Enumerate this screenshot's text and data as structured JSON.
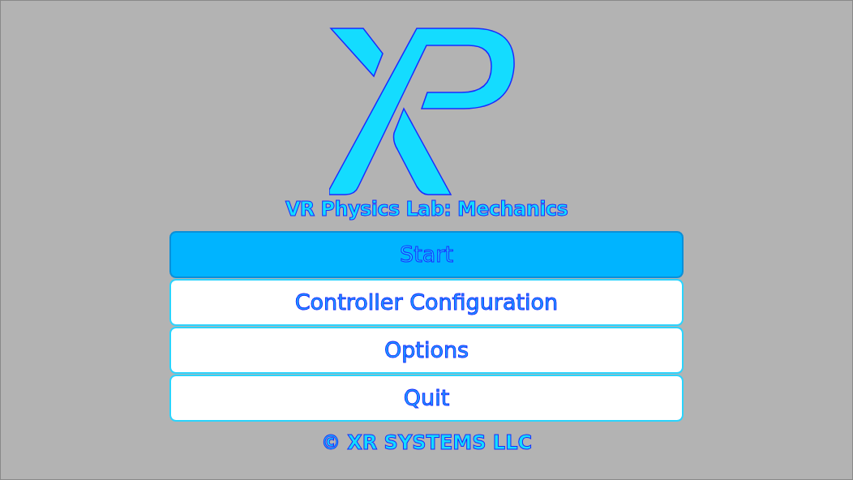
{
  "title": "VR Physics Lab: Mechanics",
  "menu": [
    {
      "label": "Start",
      "selected": true
    },
    {
      "label": "Controller Configuration",
      "selected": false
    },
    {
      "label": "Options",
      "selected": false
    },
    {
      "label": "Quit",
      "selected": false
    }
  ],
  "footer": "© XR SYSTEMS LLC"
}
